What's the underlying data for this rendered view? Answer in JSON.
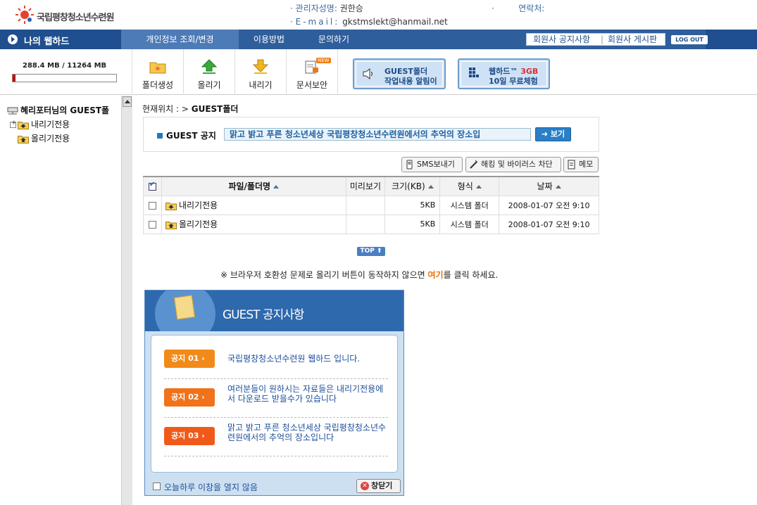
{
  "header": {
    "logo_text": "국립평창청소년수련원",
    "admin_label": "관리자성명:",
    "admin_name": "권한승",
    "email_label": "E-mail:",
    "email": "gkstmslekt@hanmail.net",
    "contact_label": "연락처:"
  },
  "nav": {
    "my_webhard": "나의 웹하드",
    "items": [
      "개인정보 조회/변경",
      "이용방법",
      "문의하기"
    ],
    "notice_member": "회원사 공지사항",
    "board_member": "회원사 게시판",
    "logout": "LOG OUT"
  },
  "toolbar": {
    "quota_text": "288.4 MB / 11264 MB",
    "quota_used_fraction": 0.0256,
    "buttons": [
      "폴더생성",
      "올리기",
      "내리기",
      "문서보안"
    ],
    "new_badge": "NEW",
    "guest_folder_line1": "GUEST폴더",
    "guest_folder_line2": "작업내용 알림이",
    "webhard_line1": "웹하드™",
    "webhard_gb": "3GB",
    "webhard_line2": "10일 무료체험"
  },
  "tree": {
    "root": "혜리포터님의 GUEST폴",
    "items": [
      "내리기전용",
      "올리기전용"
    ]
  },
  "main": {
    "breadcrumb_label": "현재위치 : >",
    "breadcrumb_current": "GUEST폴더",
    "guest_notice_title": "GUEST 공지",
    "guest_notice_msg": "맑고 밝고 푸른 청소년세상 국립평창청소년수련원에서의 추억의 장소입",
    "view_button": "보기",
    "sms_button": "SMS보내기",
    "hack_button": "해킹 및 바이러스 차단",
    "memo_button": "메모",
    "columns": [
      "파일/폴더명",
      "미리보기",
      "크기(KB)",
      "형식",
      "날짜"
    ],
    "rows": [
      {
        "name": "내리기전용",
        "preview": "",
        "size": "5KB",
        "type": "시스템 폴더",
        "date": "2008-01-07 오전 9:10"
      },
      {
        "name": "올리기전용",
        "preview": "",
        "size": "5KB",
        "type": "시스템 폴더",
        "date": "2008-01-07 오전 9:10"
      }
    ],
    "top_button": "TOP",
    "compat_prefix": "※ 브라우저 호환성 문제로 올리기 버튼이 동작하지 않으면",
    "compat_link": "여기",
    "compat_suffix": "를 클릭 하세요."
  },
  "guest_popup": {
    "title": "GUEST 공지사항",
    "notices": [
      {
        "badge": "공지 01",
        "text": "국립평창청소년수련원 웹하드 입니다."
      },
      {
        "badge": "공지 02",
        "text": "여러분들이 원하시는 자료들은 내리기전용에서 다운로드 받을수가 있습니다"
      },
      {
        "badge": "공지 03",
        "text": "맑고 밝고 푸른 청소년세상 국립평창청소년수련원에서의 추억의 장소입니다"
      }
    ],
    "dont_open_today": "오늘하루 이창을 열지 않음",
    "close_button": "창닫기"
  }
}
